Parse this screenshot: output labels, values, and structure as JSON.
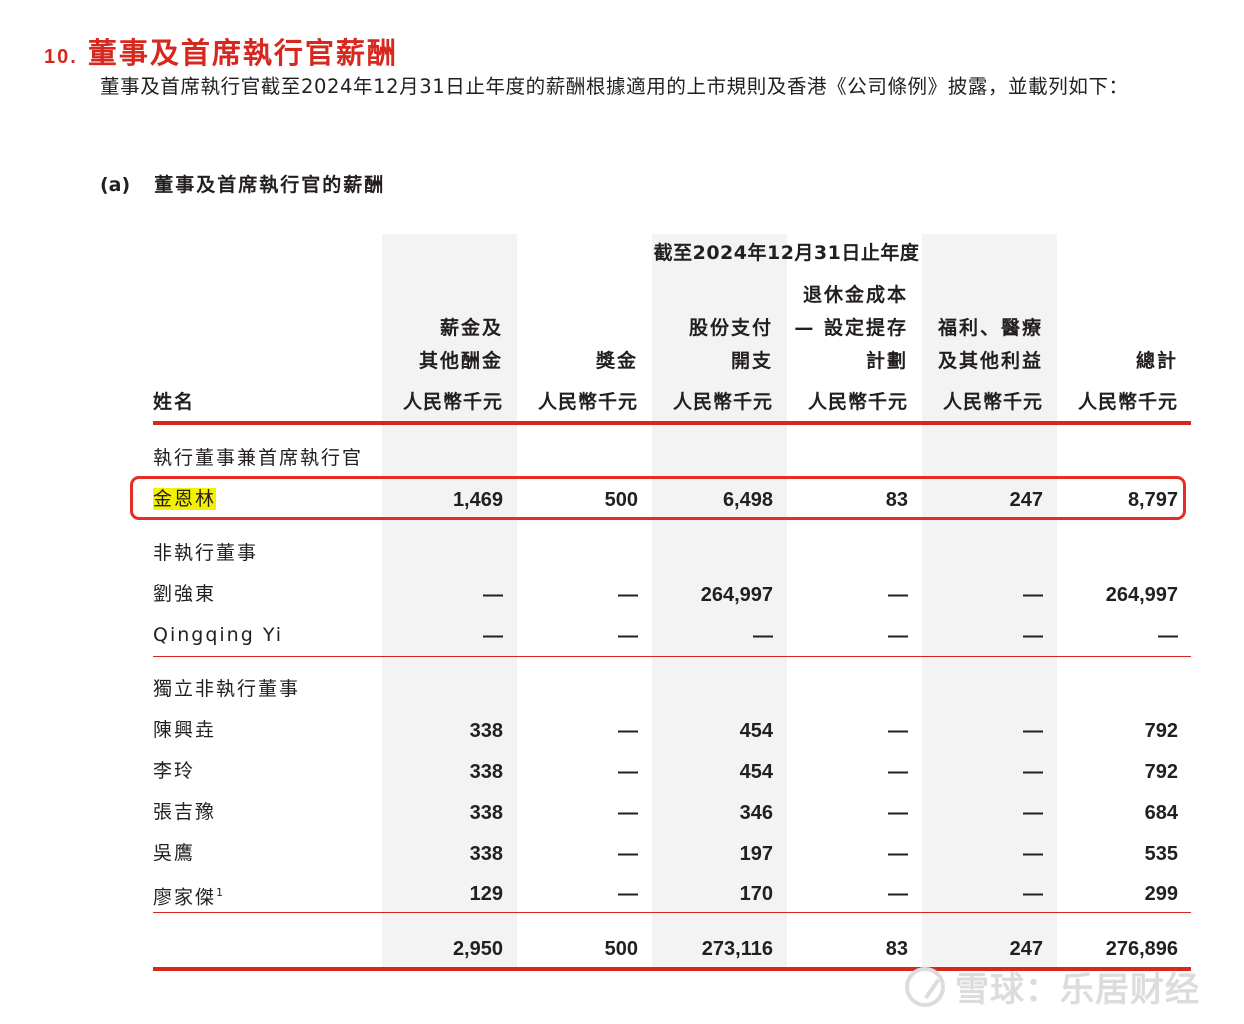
{
  "section": {
    "number": "10.",
    "title": "董事及首席執行官薪酬",
    "intro": "董事及首席執行官截至2024年12月31日止年度的薪酬根據適用的上市規則及香港《公司條例》披露，並載列如下："
  },
  "subsection": {
    "label": "(a)",
    "title": "董事及首席執行官的薪酬"
  },
  "table": {
    "period_header": "截至2024年12月31日止年度",
    "name_header": "姓名",
    "columns": [
      {
        "lines": [
          "薪金及",
          "其他酬金"
        ],
        "unit": "人民幣千元"
      },
      {
        "lines": [
          "獎金"
        ],
        "unit": "人民幣千元"
      },
      {
        "lines": [
          "股份支付",
          "開支"
        ],
        "unit": "人民幣千元"
      },
      {
        "lines": [
          "退休金成本",
          "— 設定提存",
          "計劃"
        ],
        "unit": "人民幣千元"
      },
      {
        "lines": [
          "福利、醫療",
          "及其他利益"
        ],
        "unit": "人民幣千元"
      },
      {
        "lines": [
          "總計"
        ],
        "unit": "人民幣千元"
      }
    ],
    "groups": [
      {
        "title": "執行董事兼首席執行官",
        "rows": [
          {
            "name": "金恩林",
            "values": [
              "1,469",
              "500",
              "6,498",
              "83",
              "247",
              "8,797"
            ],
            "highlighted": true
          }
        ]
      },
      {
        "title": "非執行董事",
        "rows": [
          {
            "name": "劉強東",
            "values": [
              "—",
              "—",
              "264,997",
              "—",
              "—",
              "264,997"
            ]
          },
          {
            "name": "Qingqing Yi",
            "values": [
              "—",
              "—",
              "—",
              "—",
              "—",
              "—"
            ]
          }
        ]
      },
      {
        "title": "獨立非執行董事",
        "rows": [
          {
            "name": "陳興垚",
            "values": [
              "338",
              "—",
              "454",
              "—",
              "—",
              "792"
            ]
          },
          {
            "name": "李玲",
            "values": [
              "338",
              "—",
              "454",
              "—",
              "—",
              "792"
            ]
          },
          {
            "name": "張吉豫",
            "values": [
              "338",
              "—",
              "346",
              "—",
              "—",
              "684"
            ]
          },
          {
            "name": "吳鷹",
            "values": [
              "338",
              "—",
              "197",
              "—",
              "—",
              "535"
            ]
          },
          {
            "name": "廖家傑",
            "footnote": "1",
            "values": [
              "129",
              "—",
              "170",
              "—",
              "—",
              "299"
            ]
          }
        ]
      }
    ],
    "total": [
      "2,950",
      "500",
      "273,116",
      "83",
      "247",
      "276,896"
    ]
  },
  "watermark": "雪球：乐居财经",
  "colors": {
    "accent_red": "#d7281f",
    "highlight": "#f4f100",
    "band_grey": "#f3f3f3"
  }
}
